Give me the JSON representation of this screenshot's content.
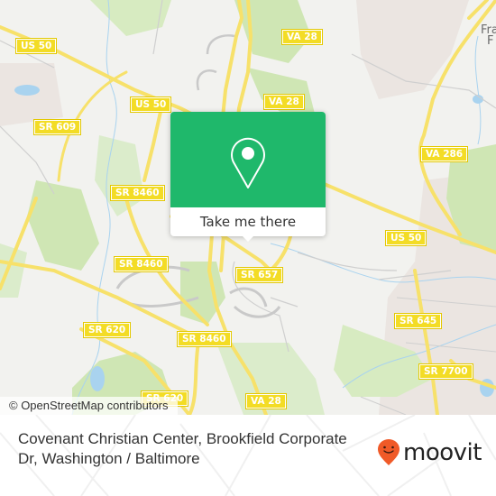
{
  "map": {
    "colors": {
      "background": "#f2f2ef",
      "forest": "#cfe6b4",
      "water": "#a9d3ef",
      "road_major": "#f7e16a",
      "road_minor": "#cfcfcf",
      "residential": "#e8e2de",
      "shield": "#f3dc25"
    },
    "shields": [
      {
        "label": "US 50"
      },
      {
        "label": "US 50"
      },
      {
        "label": "SR 609"
      },
      {
        "label": "VA 28"
      },
      {
        "label": "VA 28"
      },
      {
        "label": "SR 8460"
      },
      {
        "label": "SR 8460"
      },
      {
        "label": "SR 8460"
      },
      {
        "label": "SR 620"
      },
      {
        "label": "SR 620"
      },
      {
        "label": "SR 657"
      },
      {
        "label": "US 50"
      },
      {
        "label": "VA 286"
      },
      {
        "label": "SR 645"
      },
      {
        "label": "SR 7700"
      },
      {
        "label": "VA 28"
      }
    ],
    "places": [
      {
        "label": "Fra"
      },
      {
        "label": "F"
      }
    ],
    "attribution": "© OpenStreetMap contributors"
  },
  "popup": {
    "icon": "map-pin-icon",
    "button_label": "Take me there",
    "color": "#1fb86b"
  },
  "footer": {
    "title": "Covenant Christian Center, Brookfield Corporate Dr, Washington / Baltimore",
    "brand": {
      "name": "moovit",
      "icon": "moovit-pin-icon",
      "color": "#f05a28"
    }
  }
}
